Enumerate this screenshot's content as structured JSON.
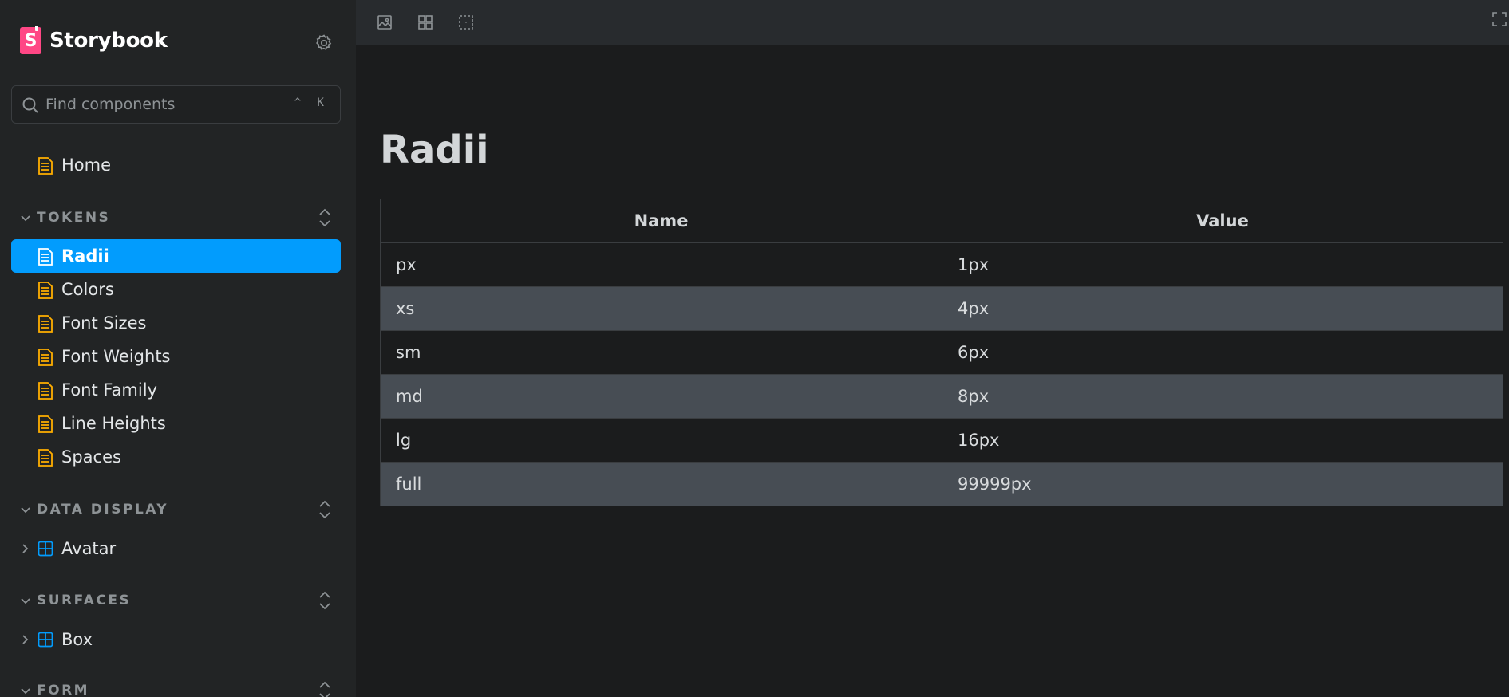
{
  "app": {
    "brand": "Storybook"
  },
  "search": {
    "placeholder": "Find components",
    "shortcut": "^ K"
  },
  "sidebar": {
    "home": {
      "label": "Home",
      "icon": "document-icon"
    },
    "sections": [
      {
        "title": "TOKENS",
        "items": [
          {
            "label": "Radii",
            "active": true
          },
          {
            "label": "Colors"
          },
          {
            "label": "Font Sizes"
          },
          {
            "label": "Font Weights"
          },
          {
            "label": "Font Family"
          },
          {
            "label": "Line Heights"
          },
          {
            "label": "Spaces"
          }
        ]
      },
      {
        "title": "DATA DISPLAY",
        "items": [
          {
            "label": "Avatar"
          }
        ]
      },
      {
        "title": "SURFACES",
        "items": [
          {
            "label": "Box"
          }
        ]
      },
      {
        "title": "FORM",
        "items": []
      }
    ]
  },
  "toolbar": {
    "tools": [
      "image-icon",
      "grid-icon",
      "outline-icon"
    ],
    "fullscreen": "fullscreen-icon"
  },
  "main": {
    "title": "Radii",
    "table": {
      "headers": [
        "Name",
        "Value"
      ],
      "rows": [
        [
          "px",
          "1px"
        ],
        [
          "xs",
          "4px"
        ],
        [
          "sm",
          "6px"
        ],
        [
          "md",
          "8px"
        ],
        [
          "lg",
          "16px"
        ],
        [
          "full",
          "99999px"
        ]
      ]
    }
  },
  "colors": {
    "accent": "#029cfd",
    "brand": "#ff4785",
    "doc_icon": "#ffae00",
    "component_icon": "#029cfd"
  }
}
